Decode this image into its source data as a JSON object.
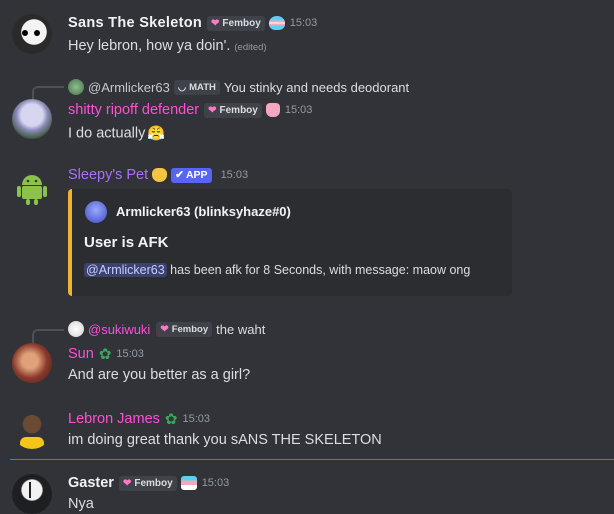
{
  "messages": [
    {
      "username": "Sans The Skeleton",
      "tag": "Femboy",
      "time": "15:03",
      "text": "Hey lebron, how ya doin'.",
      "edited": "(edited)"
    },
    {
      "reply_user": "@Armlicker63",
      "reply_tag": "MATH",
      "reply_text": "You stinky and needs deodorant",
      "username": "shitty ripoff defender",
      "tag": "Femboy",
      "time": "15:03",
      "text": "I do actually",
      "emoji": "😤"
    },
    {
      "username": "Sleepy's Pet",
      "app_label": "APP",
      "app_check": "✔",
      "time": "15:03",
      "embed": {
        "author": "Armlicker63 (blinksyhaze#0)",
        "title": "User is AFK",
        "mention": "@Armlicker63",
        "description": " has been afk for 8 Seconds, with message: maow ong"
      }
    },
    {
      "reply_user": "@sukiwuki",
      "reply_tag": "Femboy",
      "reply_text": "the waht",
      "username": "Sun",
      "time": "15:03",
      "text": "And are you better as a girl?"
    },
    {
      "username": "Lebron James",
      "time": "15:03",
      "text": "im doing great thank you sANS THE SKELETON"
    },
    {
      "username": "Gaster",
      "tag": "Femboy",
      "time": "15:03",
      "text": "Nya"
    }
  ],
  "colors": {
    "background": "#313338",
    "white_name": "#f2f3f5",
    "pink_name": "#ff4fd8",
    "purple_name": "#a970ff",
    "new_divider": "#f23f43",
    "embed_accent": "#f0b232"
  }
}
